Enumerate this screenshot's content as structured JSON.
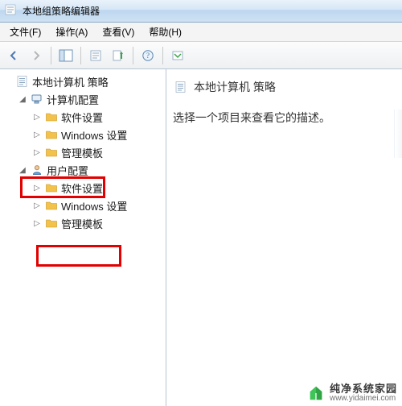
{
  "window": {
    "title": "本地组策略编辑器"
  },
  "menu": {
    "file": "文件(F)",
    "action": "操作(A)",
    "view": "查看(V)",
    "help": "帮助(H)"
  },
  "toolbar_icons": {
    "back": "back-icon",
    "forward": "forward-icon",
    "up": "up-icon",
    "show_hide": "show-hide-tree-icon",
    "export": "export-list-icon",
    "refresh": "refresh-icon",
    "help": "help-icon",
    "filter": "filter-icon"
  },
  "tree": {
    "root": {
      "label": "本地计算机 策略"
    },
    "computer": {
      "label": "计算机配置",
      "children": {
        "software": "软件设置",
        "windows": "Windows 设置",
        "admin": "管理模板"
      }
    },
    "user": {
      "label": "用户配置",
      "children": {
        "software": "软件设置",
        "windows": "Windows 设置",
        "admin": "管理模板"
      }
    }
  },
  "right": {
    "title": "本地计算机 策略",
    "description": "选择一个项目来查看它的描述。"
  },
  "watermark": {
    "name": "纯净系统家园",
    "url": "www.yidaimei.com"
  }
}
